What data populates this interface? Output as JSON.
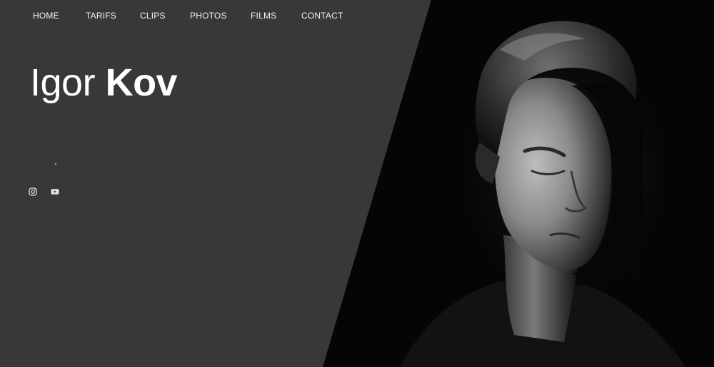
{
  "nav": {
    "items": [
      {
        "label": "HOME"
      },
      {
        "label": "TARIFS"
      },
      {
        "label": "CLIPS"
      },
      {
        "label": "PHOTOS"
      },
      {
        "label": "FILMS"
      },
      {
        "label": "CONTACT"
      }
    ]
  },
  "hero": {
    "first_name": "Igor",
    "last_name": "Kov"
  },
  "social": {
    "icons": [
      "instagram-icon",
      "youtube-icon"
    ]
  },
  "colors": {
    "panel": "#383838",
    "background": "#050505",
    "text": "#ffffff"
  }
}
